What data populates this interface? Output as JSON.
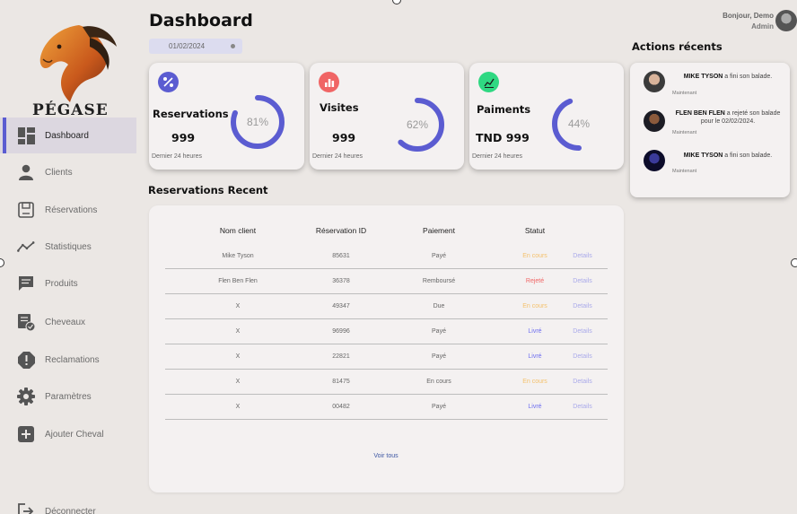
{
  "brand": {
    "name": "PÉGASE"
  },
  "sidebar": {
    "items": [
      {
        "label": "Dashboard",
        "icon": "dashboard-icon"
      },
      {
        "label": "Clients",
        "icon": "user-icon"
      },
      {
        "label": "Réservations",
        "icon": "reservation-icon"
      },
      {
        "label": "Statistiques",
        "icon": "chart-line-icon"
      },
      {
        "label": "Produits",
        "icon": "message-icon"
      },
      {
        "label": "Cheveaux",
        "icon": "checklist-icon"
      },
      {
        "label": "Reclamations",
        "icon": "alert-icon"
      },
      {
        "label": "Paramètres",
        "icon": "gear-icon"
      },
      {
        "label": "Ajouter Cheval",
        "icon": "plus-icon"
      },
      {
        "label": "Déconnecter",
        "icon": "logout-icon"
      }
    ]
  },
  "header": {
    "title": "Dashboard",
    "date": "01/02/2024",
    "greeting": "Bonjour, Demo",
    "role": "Admin"
  },
  "cards": [
    {
      "label": "Reservations",
      "value": "999",
      "percent": 81,
      "percent_text": "81%",
      "sub": "Dernier 24 heures",
      "icon": "percent-icon",
      "icon_color": "#5b5cd1"
    },
    {
      "label": "Visites",
      "value": "999",
      "percent": 62,
      "percent_text": "62%",
      "sub": "Dernier 24 heures",
      "icon": "bar-chart-icon",
      "icon_color": "#f06565"
    },
    {
      "label": "Paiments",
      "value": "TND 999",
      "percent": 44,
      "percent_text": "44%",
      "sub": "Dernier 24 heures",
      "icon": "trend-icon",
      "icon_color": "#2fd882"
    }
  ],
  "colors": {
    "accent": "#5b5cd1",
    "en_cours": "#f5c16c",
    "rejete": "#f06565",
    "livre": "#6e6ef0",
    "details": "#a9a9ea"
  },
  "reservations": {
    "title": "Reservations Recent",
    "headers": [
      "Nom client",
      "Réservation ID",
      "Paiement",
      "Statut"
    ],
    "details_label": "Details",
    "rows": [
      {
        "client": "Mike Tyson",
        "id": "85631",
        "paiement": "Payé",
        "statut": "En cours",
        "status_color": "#f5c16c"
      },
      {
        "client": "Flen Ben Flen",
        "id": "36378",
        "paiement": "Remboursé",
        "statut": "Rejeté",
        "status_color": "#f06565"
      },
      {
        "client": "X",
        "id": "49347",
        "paiement": "Due",
        "statut": "En cours",
        "status_color": "#f5c16c"
      },
      {
        "client": "X",
        "id": "96996",
        "paiement": "Payé",
        "statut": "Livré",
        "status_color": "#6e6ef0"
      },
      {
        "client": "X",
        "id": "22821",
        "paiement": "Payé",
        "statut": "Livré",
        "status_color": "#6e6ef0"
      },
      {
        "client": "X",
        "id": "81475",
        "paiement": "En cours",
        "statut": "En cours",
        "status_color": "#f5c16c"
      },
      {
        "client": "X",
        "id": "00482",
        "paiement": "Payé",
        "statut": "Livré",
        "status_color": "#6e6ef0"
      }
    ],
    "see_all": "Voir tous"
  },
  "actions": {
    "title": "Actions récents",
    "items": [
      {
        "name": "MIKE TYSON",
        "text": " a fini son balade.",
        "time": "Maintenant"
      },
      {
        "name": "FLEN BEN FLEN",
        "text": " a rejeté son balade pour le 02/02/2024.",
        "time": "Maintenant"
      },
      {
        "name": "MIKE TYSON",
        "text": " a fini son balade.",
        "time": "Maintenant"
      }
    ]
  }
}
